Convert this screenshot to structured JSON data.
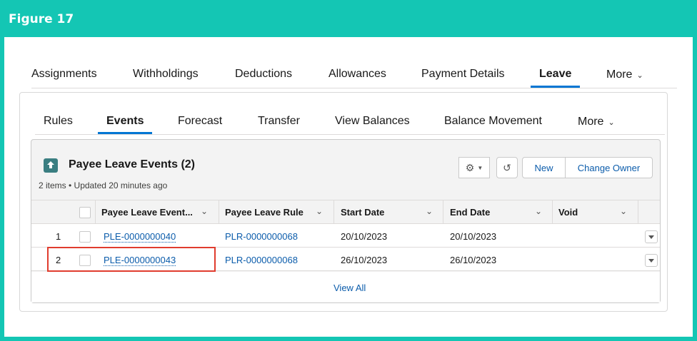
{
  "figure": {
    "title": "Figure 17"
  },
  "top_tabs": [
    {
      "label": "Assignments"
    },
    {
      "label": "Withholdings"
    },
    {
      "label": "Deductions"
    },
    {
      "label": "Allowances"
    },
    {
      "label": "Payment Details"
    },
    {
      "label": "Leave",
      "active": true
    },
    {
      "label": "More"
    }
  ],
  "sub_tabs": [
    {
      "label": "Rules"
    },
    {
      "label": "Events",
      "active": true
    },
    {
      "label": "Forecast"
    },
    {
      "label": "Transfer"
    },
    {
      "label": "View Balances"
    },
    {
      "label": "Balance Movement"
    },
    {
      "label": "More"
    }
  ],
  "related_list": {
    "icon": "payee-leave-icon",
    "title": "Payee Leave Events (2)",
    "subtitle": "2 items • Updated 20 minutes ago",
    "buttons": {
      "settings_icon": "gear-icon",
      "refresh_icon": "refresh-icon",
      "new": "New",
      "change_owner": "Change Owner"
    },
    "columns": [
      "Payee Leave Event...",
      "Payee Leave Rule",
      "Start Date",
      "End Date",
      "Void"
    ],
    "rows": [
      {
        "num": "1",
        "event": "PLE-0000000040",
        "rule": "PLR-0000000068",
        "start": "20/10/2023",
        "end": "20/10/2023",
        "void": ""
      },
      {
        "num": "2",
        "event": "PLE-0000000043",
        "rule": "PLR-0000000068",
        "start": "26/10/2023",
        "end": "26/10/2023",
        "void": ""
      }
    ],
    "view_all": "View All"
  },
  "colors": {
    "frame": "#14c6b4",
    "accent": "#0176d3",
    "link": "#0b5cab",
    "highlight": "#e03c2e"
  }
}
